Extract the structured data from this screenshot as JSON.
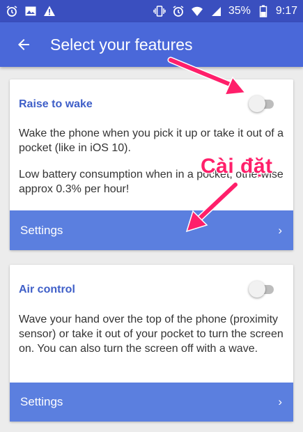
{
  "statusbar": {
    "battery_percent": "35%",
    "time": "9:17",
    "left_icons": [
      "alarm-clock-icon",
      "image-icon",
      "warning-icon"
    ],
    "right_icons": [
      "vibrate-icon",
      "alarm-clock-icon",
      "wifi-icon",
      "signal-icon",
      "battery-icon"
    ]
  },
  "appbar": {
    "title": "Select your features",
    "back_icon": "arrow-back-icon",
    "color": "#4a68d9"
  },
  "features": [
    {
      "title": "Raise to wake",
      "enabled": false,
      "description": "Wake the phone when you pick it up or take it out of a pocket (like in iOS 10).",
      "description2": "Low battery consumption when in a pocket, otherwise approx 0.3% per hour!",
      "settings_label": "Settings",
      "chevron": "›"
    },
    {
      "title": "Air control",
      "enabled": false,
      "description": "Wave your hand over the top of the phone (proximity sensor) or take it out of your pocket to turn the screen on. You can also turn the screen off with a wave.",
      "settings_label": "Settings",
      "chevron": "›"
    }
  ],
  "annotation": {
    "text": "Cài đặt",
    "color": "#ff1f6a"
  },
  "colors": {
    "accent": "#3f5fc8",
    "settings_bar": "#5b7fdf",
    "status_bar": "#3a4fbf"
  }
}
